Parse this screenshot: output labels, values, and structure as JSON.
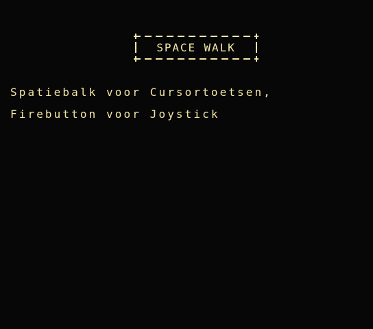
{
  "screen": {
    "title": "SPACE WALK",
    "instructions": [
      "Spatiebalk voor Cursortoetsen,",
      "Firebutton voor Joystick"
    ]
  },
  "colors": {
    "background": "#070707",
    "text": "#f3e5a6"
  }
}
